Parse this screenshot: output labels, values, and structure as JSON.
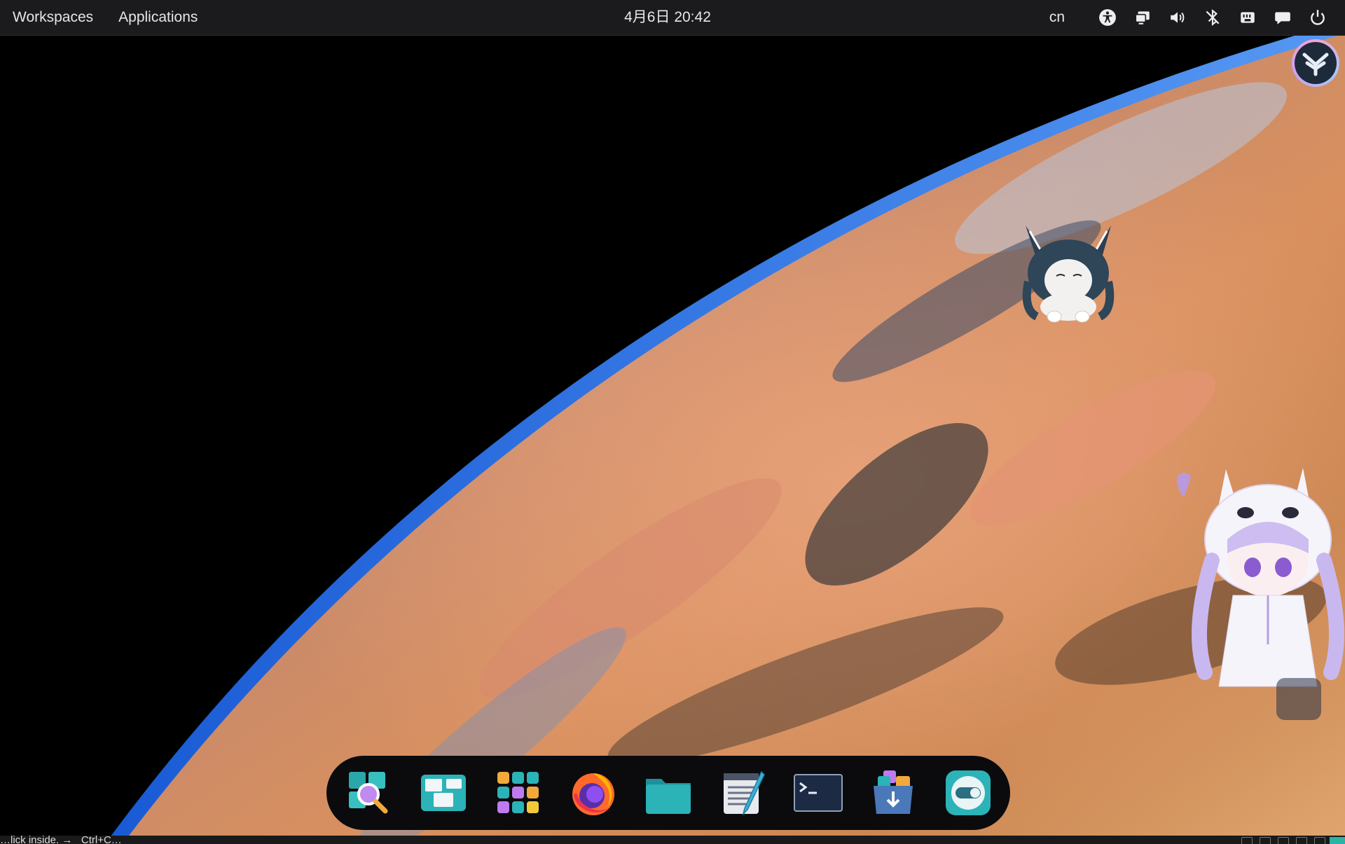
{
  "topbar": {
    "workspaces_label": "Workspaces",
    "applications_label": "Applications",
    "clock": "4月6日 20:42",
    "input_method": "cn",
    "tray_icons": [
      "accessibility-icon",
      "display-icon",
      "volume-icon",
      "bluetooth-off-icon",
      "network-wired-icon",
      "chat-icon",
      "power-icon"
    ]
  },
  "dock": {
    "items": [
      {
        "name": "search-app-icon"
      },
      {
        "name": "window-overview-icon"
      },
      {
        "name": "app-grid-icon"
      },
      {
        "name": "firefox-icon"
      },
      {
        "name": "files-folder-icon"
      },
      {
        "name": "text-editor-icon"
      },
      {
        "name": "terminal-icon"
      },
      {
        "name": "software-installer-icon"
      },
      {
        "name": "toggle-settings-icon"
      }
    ]
  },
  "bottom_strip": {
    "text": "…lick inside. →_ Ctrl+C…"
  },
  "colors": {
    "topbar_bg": "#1b1b1d",
    "dock_bg": "#0b0b0d",
    "accent_teal": "#2bb3a3"
  }
}
